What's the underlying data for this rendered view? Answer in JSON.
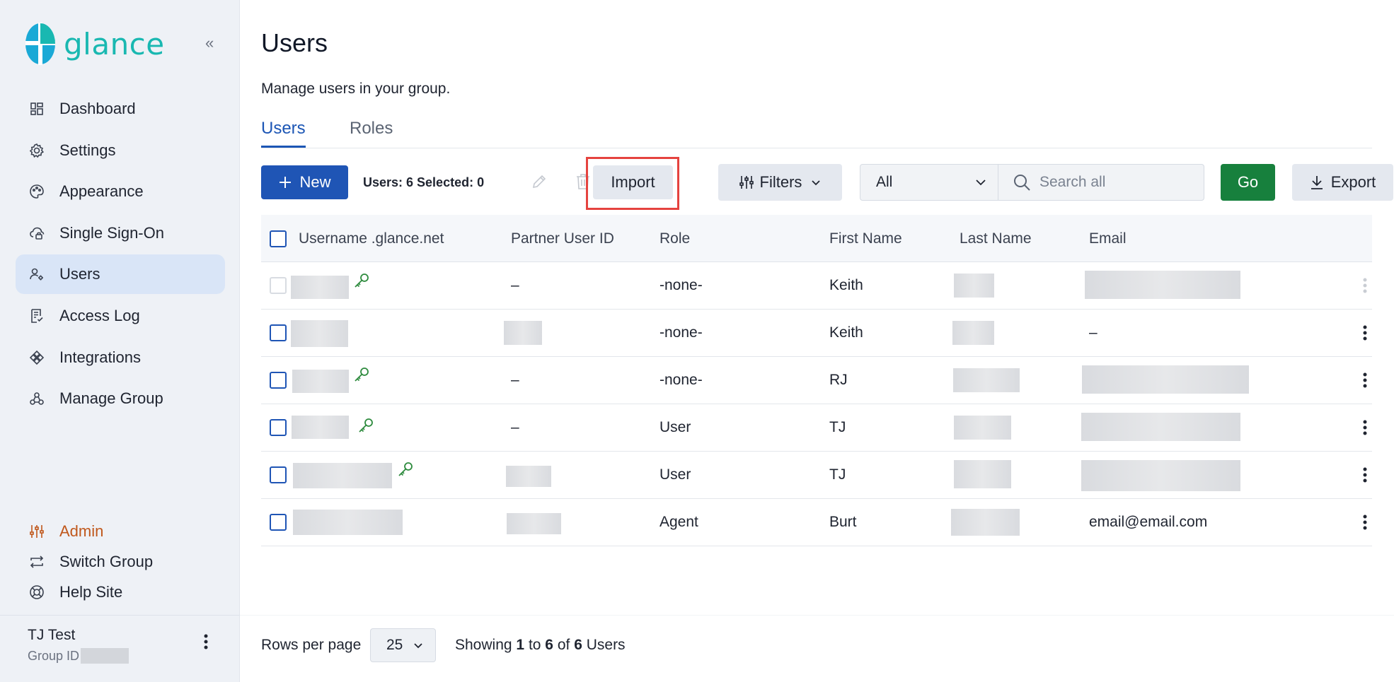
{
  "brand": {
    "name": "glance",
    "accent": "#19b8b1",
    "primary": "#1f55b5",
    "go_color": "#17803d",
    "highlight": "#e5433f"
  },
  "sidebar": {
    "collapse_icon": "«",
    "items": [
      {
        "label": "Dashboard",
        "icon": "dashboard-icon"
      },
      {
        "label": "Settings",
        "icon": "gear-icon"
      },
      {
        "label": "Appearance",
        "icon": "palette-icon"
      },
      {
        "label": "Single Sign-On",
        "icon": "cloud-lock-icon"
      },
      {
        "label": "Users",
        "icon": "users-icon",
        "active": true
      },
      {
        "label": "Access Log",
        "icon": "log-icon"
      },
      {
        "label": "Integrations",
        "icon": "integrations-icon"
      },
      {
        "label": "Manage Group",
        "icon": "group-icon"
      }
    ],
    "bottom": [
      {
        "label": "Admin",
        "icon": "sliders-icon"
      },
      {
        "label": "Switch Group",
        "icon": "switch-icon"
      },
      {
        "label": "Help Site",
        "icon": "lifebuoy-icon"
      }
    ],
    "user": {
      "name": "TJ Test",
      "group_label": "Group ID"
    }
  },
  "page": {
    "title": "Users",
    "subtitle": "Manage users in your group."
  },
  "tabs": [
    {
      "label": "Users",
      "active": true
    },
    {
      "label": "Roles"
    }
  ],
  "toolbar": {
    "new_label": "New",
    "counts": "Users: 6 Selected: 0",
    "import_label": "Import",
    "filters_label": "Filters",
    "scope_value": "All",
    "search_placeholder": "Search all",
    "go_label": "Go",
    "export_label": "Export"
  },
  "table": {
    "headers": [
      "Username .glance.net",
      "Partner User ID",
      "Role",
      "First Name",
      "Last Name",
      "Email"
    ],
    "rows": [
      {
        "partner": "–",
        "role": "-none-",
        "first": "Keith",
        "email": ""
      },
      {
        "partner": "",
        "role": "-none-",
        "first": "Keith",
        "email": "–"
      },
      {
        "partner": "–",
        "role": "-none-",
        "first": "RJ",
        "email": ""
      },
      {
        "partner": "–",
        "role": "User",
        "first": "TJ",
        "email": ""
      },
      {
        "partner": "",
        "role": "User",
        "first": "TJ",
        "email": ""
      },
      {
        "partner": "",
        "role": "Agent",
        "first": "Burt",
        "email": "email@email.com"
      }
    ]
  },
  "footer": {
    "rows_label": "Rows per page",
    "rows_value": "25",
    "showing_prefix": "Showing",
    "from": "1",
    "to_word": "to",
    "to": "6",
    "of_word": "of",
    "total": "6",
    "suffix": "Users"
  }
}
